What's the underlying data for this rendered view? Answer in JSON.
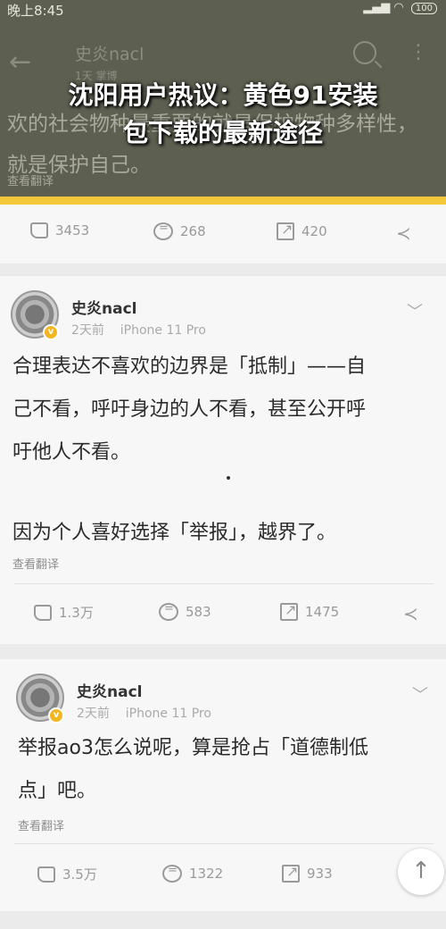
{
  "status_bar": {
    "time": "晚上8:45",
    "signal": "▂▄▆",
    "wifi": "◠",
    "battery": "100"
  },
  "nav": {
    "back": "←",
    "title": "史炎nacl",
    "subtitle": "1天 掌博",
    "more": "⋮"
  },
  "background_post": {
    "text": "欢的社会物种最重要的就是保护物种多样性，就是保护自己。",
    "translate": "查看翻译"
  },
  "overlay": {
    "headline_line1": "沈阳用户热议：黄色91安装",
    "headline_line2": "包下载的最新途径"
  },
  "top_actions": {
    "likes": "3453",
    "comments": "268",
    "shares": "420"
  },
  "posts": [
    {
      "username": "史炎nacl",
      "time": "2天前",
      "device": "iPhone 11 Pro",
      "lines": [
        "合理表达不喜欢的边界是「抵制」——自",
        "己不看，呼吁身边的人不看，甚至公开呼",
        "吁他人不看。",
        "因为个人喜好选择「举报」，越界了。"
      ],
      "translate": "查看翻译",
      "likes": "1.3万",
      "comments": "583",
      "shares": "1475"
    },
    {
      "username": "史炎nacl",
      "time": "2天前",
      "device": "iPhone 11 Pro",
      "lines": [
        "举报ao3怎么说呢，算是抢占「道德制低",
        "点」吧。"
      ],
      "translate": "查看翻译",
      "likes": "3.5万",
      "comments": "1322",
      "shares": "933"
    }
  ],
  "icons": {
    "like": "thumbs-up-icon",
    "comment": "comment-icon",
    "share": "share-icon",
    "more": "share-nodes-icon",
    "chevron": "chevron-down-icon",
    "scroll_top": "arrow-up-icon"
  },
  "ui": {
    "chevron": "﹀",
    "share_nodes": "≺",
    "scroll_top": "↑",
    "badge": "v"
  },
  "colors": {
    "accent_yellow": "#f3c73a",
    "verified_badge": "#f2b620"
  }
}
